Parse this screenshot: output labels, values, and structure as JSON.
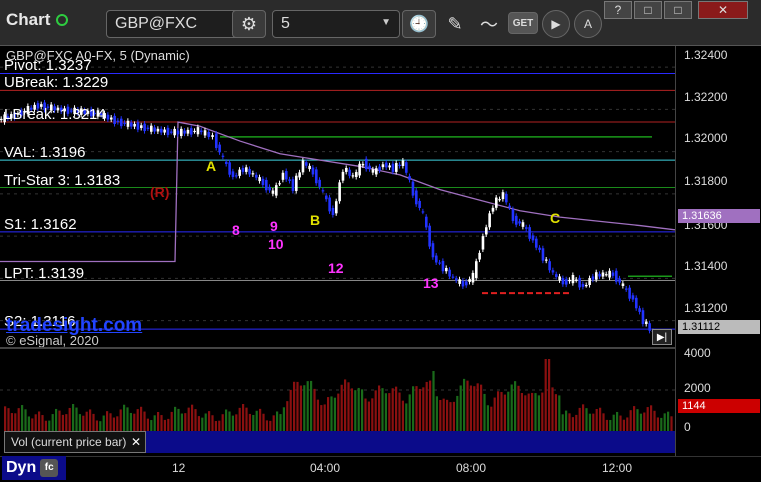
{
  "toolbar": {
    "title": "Chart",
    "symbol": "GBP@FXC",
    "interval": "5",
    "get_label": "GET",
    "win_buttons": [
      "?",
      "□",
      "□",
      "✕"
    ]
  },
  "chart": {
    "header": "GBP@FXC A0-FX, 5 (Dynamic)",
    "watermark": "tradesight.com",
    "copyright": "© eSignal, 2020",
    "levels": [
      {
        "label": "Pivot: 1.3237",
        "price": 1.3237,
        "color": "#2a2aff"
      },
      {
        "label": "UBreak: 1.3229",
        "price": 1.3229,
        "color": "#b22222"
      },
      {
        "label": "LBreak: 1.3214",
        "price": 1.3214,
        "color": "#b22222"
      },
      {
        "label": "VAL: 1.3196",
        "price": 1.3196,
        "color": "#3fd3e0"
      },
      {
        "label": "Tri-Star 3: 1.3183",
        "price": 1.3183,
        "color": "#1a8a1a"
      },
      {
        "label": "S1: 1.3162",
        "price": 1.3162,
        "color": "#2a2aff"
      },
      {
        "label": "LPT: 1.3139",
        "price": 1.3139,
        "color": "#888888"
      },
      {
        "label": "S2: 1.3116",
        "price": 1.3116,
        "color": "#2a2aff"
      }
    ],
    "annotations": [
      {
        "text": "A",
        "color": "#e0e000"
      },
      {
        "text": "B",
        "color": "#e0e000"
      },
      {
        "text": "C",
        "color": "#e0e000"
      },
      {
        "text": "(R)",
        "color": "#b01010"
      },
      {
        "text": "8",
        "color": "#ff33ff"
      },
      {
        "text": "9",
        "color": "#ff33ff"
      },
      {
        "text": "10",
        "color": "#ff33ff"
      },
      {
        "text": "12",
        "color": "#ff33ff"
      },
      {
        "text": "13",
        "color": "#ff33ff"
      }
    ],
    "price_axis": [
      "1.32400",
      "1.32200",
      "1.32000",
      "1.31800",
      "1.31600",
      "1.31400",
      "1.31200"
    ],
    "current_price": "1.31112",
    "marker_price": "1.31636",
    "ylim": [
      1.3108,
      1.325
    ]
  },
  "volume": {
    "label": "Vol (current price bar)",
    "axis": [
      "4000",
      "2000",
      "0"
    ],
    "current": "1144"
  },
  "xaxis": {
    "labels": [
      "12",
      "04:00",
      "08:00",
      "12:00"
    ]
  },
  "footer": {
    "dyn_label": "Dyn"
  },
  "colors": {
    "candle_up": "#ffffff",
    "candle_down": "#2233ff",
    "ma": "#a070c0",
    "vol_bar": "#8a1010",
    "vol_bar_up": "#1a6a1a"
  }
}
